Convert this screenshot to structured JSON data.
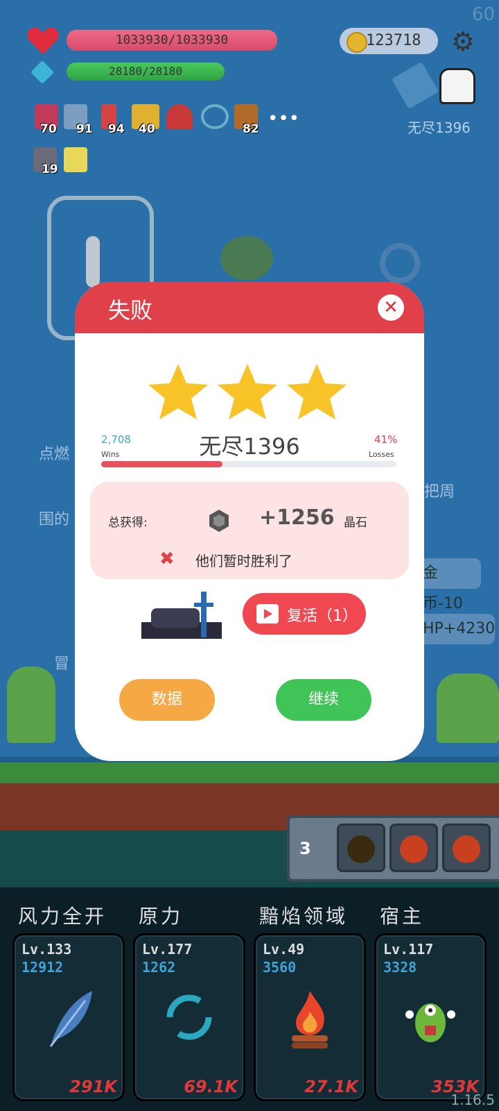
{
  "fps": "60",
  "hud": {
    "hp": "1033930/1033930",
    "mp": "28180/28180",
    "coins": "123718",
    "mode_label": "无尽1396"
  },
  "items": [
    {
      "icon": "jam-jar-icon",
      "count": "70",
      "color": "#c03a5c"
    },
    {
      "icon": "star-card-icon",
      "count": "91",
      "color": "#7e9ec0"
    },
    {
      "icon": "sock-icon",
      "count": "94",
      "color": "#d44444"
    },
    {
      "icon": "crown-icon",
      "count": "40",
      "color": "#e0b030"
    },
    {
      "icon": "magnet-icon",
      "count": "",
      "color": "#c83a3a"
    },
    {
      "icon": "magnifier-icon",
      "count": "",
      "color": "#6ab0c8"
    },
    {
      "icon": "book-icon",
      "count": "82",
      "color": "#b06a2a"
    }
  ],
  "items_row2": [
    {
      "icon": "sword-scroll-icon",
      "count": "19",
      "color": "#6a6a7a"
    },
    {
      "icon": "glowing-tile-icon",
      "count": "",
      "color": "#e8d85a"
    }
  ],
  "side": {
    "text1": "点燃",
    "text2": "把周",
    "text3": "围的",
    "pill1": "金币-10",
    "pill2": "HP+4230",
    "text4": "冒"
  },
  "dialog": {
    "title": "失败",
    "wins_count": "2,708",
    "wins_label": "Wins",
    "losses_pct": "41%",
    "losses_label": "Losses",
    "level": "无尽1396",
    "win_ratio": 0.41,
    "reward_label": "总获得:",
    "reward_value": "+1256",
    "reward_unit": "晶石",
    "result_msg": "他们暂时胜利了",
    "revive_label": "复活（1）",
    "data_button": "数据",
    "continue_button": "继续"
  },
  "potions": {
    "count": "3"
  },
  "skills": [
    {
      "name": "风力全开",
      "lv": "Lv.133",
      "count": "12912",
      "cost": "291K",
      "icon": "feather-icon"
    },
    {
      "name": "原力",
      "lv": "Lv.177",
      "count": "1262",
      "cost": "69.1K",
      "icon": "cycle-arrows-icon"
    },
    {
      "name": "黯焰领域",
      "lv": "Lv.49",
      "count": "3560",
      "cost": "27.1K",
      "icon": "campfire-icon"
    },
    {
      "name": "宿主",
      "lv": "Lv.117",
      "count": "3328",
      "cost": "353K",
      "icon": "green-monster-icon"
    }
  ],
  "version": "1.16.5"
}
